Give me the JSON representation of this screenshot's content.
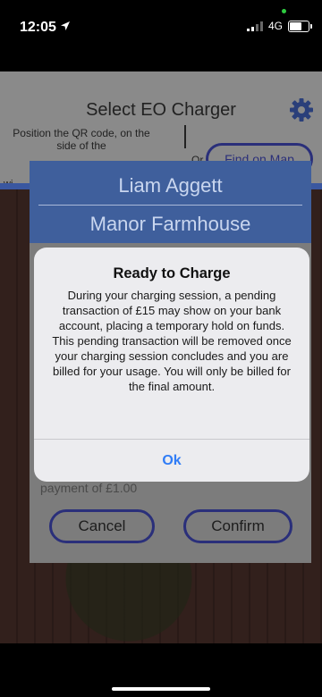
{
  "status_bar": {
    "time": "12:05",
    "network": "4G"
  },
  "app": {
    "title": "Select EO Charger",
    "instruction": "Position the QR code, on the side of the",
    "or_label": "Or",
    "find_on_map": "Find on Map",
    "partial_text": "wi"
  },
  "charger_panel": {
    "name": "Liam Aggett",
    "location": "Manor Farmhouse",
    "payment_text": "payment of £1.00",
    "cancel_label": "Cancel",
    "confirm_label": "Confirm"
  },
  "alert": {
    "title": "Ready to Charge",
    "message": "During your charging session, a pending transaction of £15 may show on your bank account, placing a temporary hold on funds. This pending transaction will be removed once your charging session concludes and you are billed for your usage. You will only be billed for the final amount.",
    "ok_label": "Ok"
  },
  "colors": {
    "accent": "#2f7cf6",
    "panel_header": "#3f5f9c",
    "button_border": "#2a2f7a"
  },
  "icons": [
    "location-arrow-icon",
    "signal-icon",
    "battery-icon",
    "gear-icon"
  ]
}
